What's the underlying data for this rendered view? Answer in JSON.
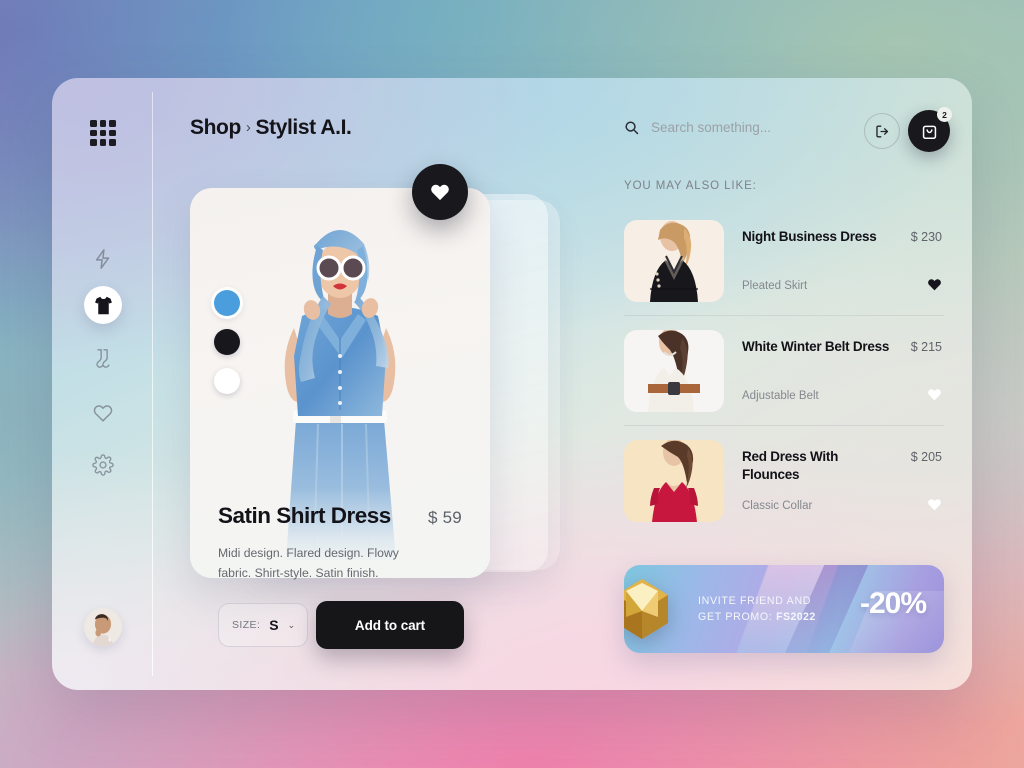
{
  "brand": {
    "logo_icon": "grid-dots-icon"
  },
  "sidebar": {
    "items": [
      {
        "icon": "lightning-bolt-icon",
        "active": false
      },
      {
        "icon": "tshirt-icon",
        "active": true
      },
      {
        "icon": "socks-icon",
        "active": false
      },
      {
        "icon": "heart-icon",
        "active": false
      },
      {
        "icon": "gear-icon",
        "active": false
      }
    ],
    "avatar_icon": "user-avatar"
  },
  "header": {
    "breadcrumb_root": "Shop",
    "breadcrumb_separator": "›",
    "breadcrumb_current": "Stylist A.I.",
    "search_placeholder": "Search something...",
    "search_value": "",
    "search_icon": "search-icon",
    "logout_icon": "logout-icon",
    "cart_icon": "shopping-bag-icon",
    "cart_count": "2"
  },
  "product": {
    "title": "Satin Shirt Dress",
    "price": "$ 59",
    "description": "Midi design. Flared design. Flowy fabric. Shirt-style. Satin finish.",
    "favorite_icon": "heart-filled-icon",
    "size_label": "SIZE:",
    "size_value": "S",
    "size_chevron": "⌄",
    "add_to_cart_label": "Add to cart",
    "colors": [
      {
        "name": "blue",
        "hex": "#4a9ede",
        "selected": true
      },
      {
        "name": "black",
        "hex": "#17171c",
        "selected": false
      },
      {
        "name": "white",
        "hex": "#ffffff",
        "selected": false
      }
    ]
  },
  "suggestions": {
    "heading": "YOU MAY ALSO LIKE:",
    "items": [
      {
        "name": "Night Business Dress",
        "price": "$ 230",
        "subtitle": "Pleated Skirt",
        "favorited": true,
        "heart_icon": "heart-filled-icon"
      },
      {
        "name": "White Winter Belt Dress",
        "price": "$ 215",
        "subtitle": "Adjustable Belt",
        "favorited": false,
        "heart_icon": "heart-white-icon"
      },
      {
        "name": "Red Dress With Flounces",
        "price": "$ 205",
        "subtitle": "Classic Collar",
        "favorited": false,
        "heart_icon": "heart-white-icon"
      }
    ]
  },
  "promo": {
    "line1": "INVITE FRIEND AND",
    "line2_prefix": "GET PROMO: ",
    "code": "FS2022",
    "discount": "-20%",
    "gem_icon": "gold-polyhedron-icon"
  },
  "colors": {
    "accent_blue": "#4a9ede",
    "dark": "#161619",
    "muted_text": "#84888e"
  }
}
